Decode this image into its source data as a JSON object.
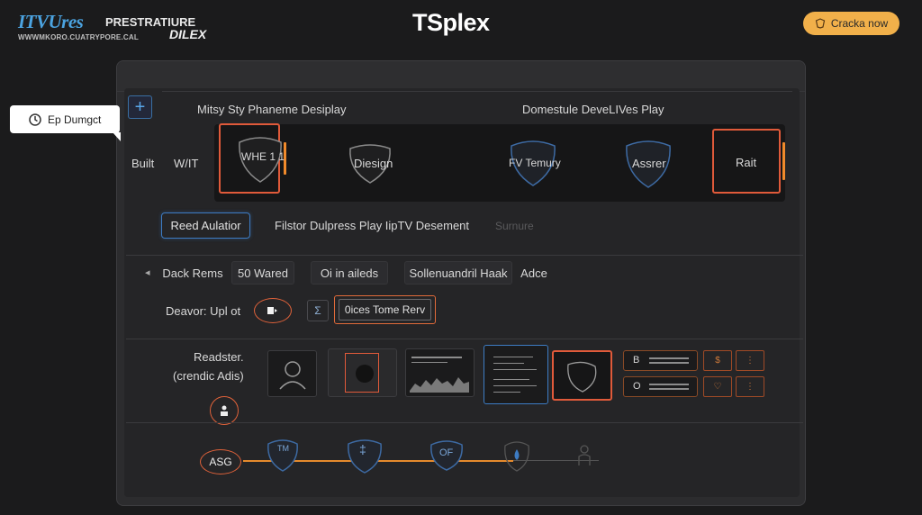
{
  "brand": {
    "name": "ITVUres",
    "tagline_right": "PRESTRATIURE",
    "sub": "WWWMKORO.CUATRYPORE.CAL",
    "sub_right": "DILEX"
  },
  "app_title": "TSplex",
  "cta": {
    "label": "Cracka now",
    "icon": "badge-icon"
  },
  "tooltip": {
    "label": "Ep Dumgct",
    "icon": "clock-icon"
  },
  "toolbar": {
    "add_icon": "plus-icon",
    "add_label": "+"
  },
  "sections": {
    "left_header": "Mitsy Sty Phaneme Desiplay",
    "right_header": "Domestule DeveLIVes Play",
    "side_label_1": "Built",
    "side_label_2": "W/IT"
  },
  "row1": {
    "items": [
      {
        "label": "WHE 1 1",
        "selected": true
      },
      {
        "label": "Diesign",
        "selected": false
      },
      {
        "label": "FV Temury",
        "selected": false
      },
      {
        "label": "Assrer",
        "selected": false
      },
      {
        "label": "Rait",
        "selected": true
      }
    ]
  },
  "row2": {
    "primary_button": "Reed Aulatior",
    "description": "Filstor Dulpress Play IipTV Desement",
    "ghost_text": "Surnure"
  },
  "row3": {
    "chips": [
      "Dack Rems",
      "50 Wared",
      "Oi in aileds",
      "Sollenuandril Haak",
      "Adce"
    ]
  },
  "row4": {
    "label": "Deavor: Upl ot",
    "oval_icon": "play-icon",
    "sigma_icon": "sigma-icon",
    "sigma_label": "Σ",
    "action_button": "0ices Tome Rerv"
  },
  "row5": {
    "label_1": "Readster.",
    "label_2": "(crendic Adis)",
    "pin_icon": "user-pin-icon",
    "list_rows": [
      {
        "key": "B"
      },
      {
        "key": "O"
      }
    ],
    "mini_cells": [
      "$",
      "⋮",
      "♡",
      "⋮"
    ]
  },
  "row6": {
    "label": "ASG",
    "nodes": [
      {
        "label": "TM",
        "icon": "shield-icon"
      },
      {
        "label": "‡",
        "icon": "shield-icon"
      },
      {
        "label": "OF",
        "icon": "shield-icon"
      },
      {
        "label": "",
        "icon": "drop-icon"
      },
      {
        "label": "",
        "icon": "person-icon"
      }
    ]
  },
  "colors": {
    "background": "#1b1b1c",
    "panel": "#2c2c2e",
    "accent_orange": "#e05a3a",
    "accent_blue": "#3d7cc4",
    "cta": "#f1b04a"
  }
}
